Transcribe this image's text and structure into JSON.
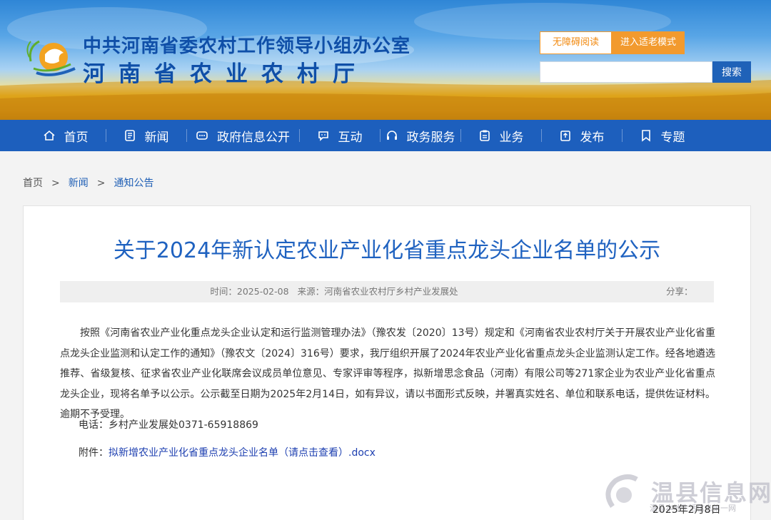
{
  "header": {
    "org_title": "中共河南省委农村工作领导小组办公室",
    "org_name": "河南省农业农村厅",
    "accessibility_label": "无障碍阅读",
    "elder_mode_label": "进入适老模式",
    "search_placeholder": "",
    "search_button": "搜索",
    "colors": {
      "brand_blue": "#1d5fbd",
      "accent_orange": "#f29a2e"
    }
  },
  "nav": {
    "items": [
      {
        "label": "首页",
        "icon": "home-icon"
      },
      {
        "label": "新闻",
        "icon": "news-icon"
      },
      {
        "label": "政府信息公开",
        "icon": "gov-info-icon"
      },
      {
        "label": "互动",
        "icon": "chat-icon"
      },
      {
        "label": "政务服务",
        "icon": "headset-icon"
      },
      {
        "label": "业务",
        "icon": "clipboard-icon"
      },
      {
        "label": "发布",
        "icon": "publish-icon"
      },
      {
        "label": "专题",
        "icon": "bookmark-icon"
      }
    ]
  },
  "breadcrumb": {
    "items": [
      "首页",
      "新闻",
      "通知公告"
    ],
    "separator": ">"
  },
  "article": {
    "title": "关于2024年新认定农业产业化省重点龙头企业名单的公示",
    "time": "时间：2025-02-08",
    "source": "来源：河南省农业农村厅乡村产业发展处",
    "share_label": "分享：",
    "body": "按照《河南省农业产业化重点龙头企业认定和运行监测管理办法》（豫农发〔2020〕13号）规定和《河南省农业农村厅关于开展农业产业化省重点龙头企业监测和认定工作的通知》（豫农文〔2024〕316号）要求，我厅组织开展了2024年农业产业化省重点龙头企业监测认定工作。经各地遴选推荐、省级复核、征求省农业产业化联席会议成员单位意见、专家评审等程序，拟新增思念食品（河南）有限公司等271家企业为农业产业化省重点龙头企业，现将名单予以公示。公示截至日期为2025年2月14日，如有异议，请以书面形式反映，并署真实姓名、单位和联系电话，提供佐证材料。逾期不予受理。",
    "phone": "电话：乡村产业发展处0371-65918869",
    "attachment_label": "附件：",
    "attachment_link": "拟新增农业产业化省重点龙头企业名单（请点击查看）.docx",
    "signed_date": "2025年2月8日"
  },
  "watermark": {
    "text": "温县信息网",
    "sub": "温县本地生活信息第一网"
  }
}
